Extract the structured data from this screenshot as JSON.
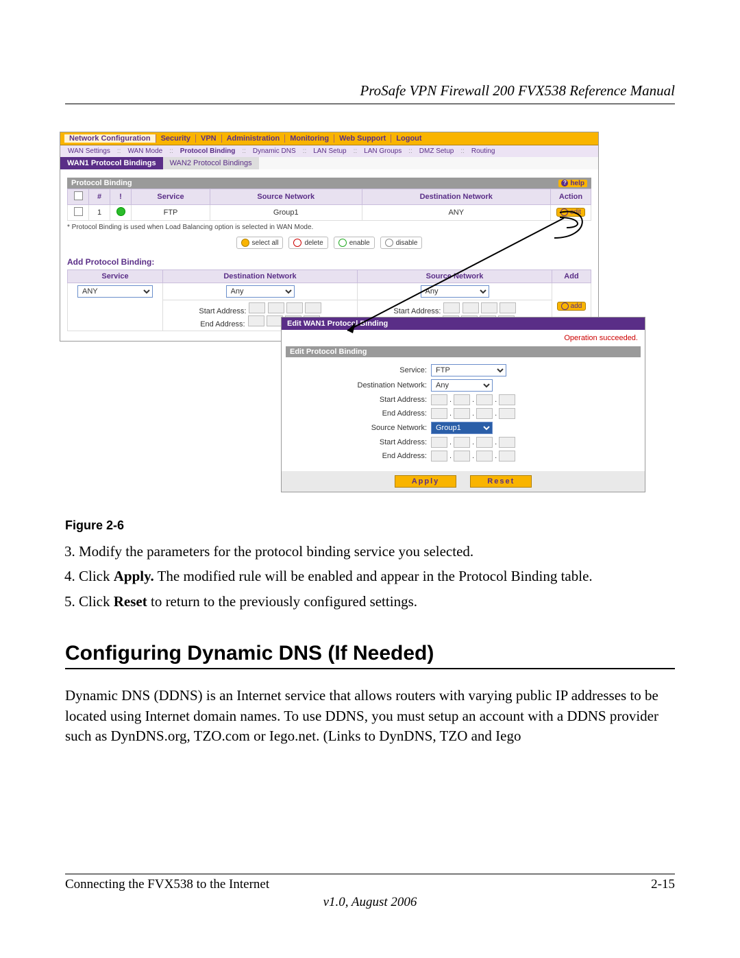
{
  "header": {
    "title": "ProSafe VPN Firewall 200 FVX538 Reference Manual"
  },
  "nav1": [
    "Network Configuration",
    "Security",
    "VPN",
    "Administration",
    "Monitoring",
    "Web Support",
    "Logout"
  ],
  "nav1_active": 0,
  "nav2": [
    "WAN Settings",
    "WAN Mode",
    "Protocol Binding",
    "Dynamic DNS",
    "LAN Setup",
    "LAN Groups",
    "DMZ Setup",
    "Routing"
  ],
  "nav2_active": 2,
  "tabs": {
    "a": "WAN1 Protocol Bindings",
    "b": "WAN2 Protocol Bindings"
  },
  "panel": {
    "bar": "Protocol Binding",
    "help": "help",
    "cols": [
      "#",
      "!",
      "Service",
      "Source Network",
      "Destination Network",
      "Action"
    ],
    "row": {
      "num": "1",
      "service": "FTP",
      "src": "Group1",
      "dst": "ANY",
      "action": "edit"
    },
    "note": "* Protocol Binding is used when Load Balancing option is selected in WAN Mode.",
    "buttons": {
      "selectall": "select all",
      "delete": "delete",
      "enable": "enable",
      "disable": "disable"
    }
  },
  "add": {
    "heading": "Add Protocol Binding:",
    "cols": [
      "Service",
      "Destination Network",
      "Source Network",
      "Add"
    ],
    "service_value": "ANY",
    "net_value": "Any",
    "start": "Start Address:",
    "end": "End Address:",
    "addbtn": "add"
  },
  "edit": {
    "title": "Edit WAN1 Protocol Binding",
    "msg": "Operation succeeded.",
    "bar": "Edit Protocol Binding",
    "labels": {
      "service": "Service:",
      "dst": "Destination Network:",
      "src": "Source Network:",
      "start": "Start Address:",
      "end": "End Address:"
    },
    "service_val": "FTP",
    "dst_val": "Any",
    "src_val": "Group1",
    "apply": "Apply",
    "reset": "Reset"
  },
  "figcap": "Figure 2-6",
  "steps": {
    "s3": "Modify the parameters for the protocol binding service you selected.",
    "s4a": "Click ",
    "s4b": "Apply.",
    "s4c": " The modified rule will be enabled and appear in the Protocol Binding table.",
    "s5a": "Click ",
    "s5b": "Reset",
    "s5c": " to return to the previously configured settings."
  },
  "section": "Configuring Dynamic DNS (If Needed)",
  "para": "Dynamic DNS (DDNS) is an Internet service that allows routers with varying public IP addresses to be located using Internet domain names. To use DDNS, you must setup an account with a DDNS provider such as DynDNS.org, TZO.com or Iego.net. (Links to DynDNS, TZO and Iego",
  "footer": {
    "left": "Connecting the FVX538 to the Internet",
    "right": "2-15",
    "ver": "v1.0, August 2006"
  }
}
